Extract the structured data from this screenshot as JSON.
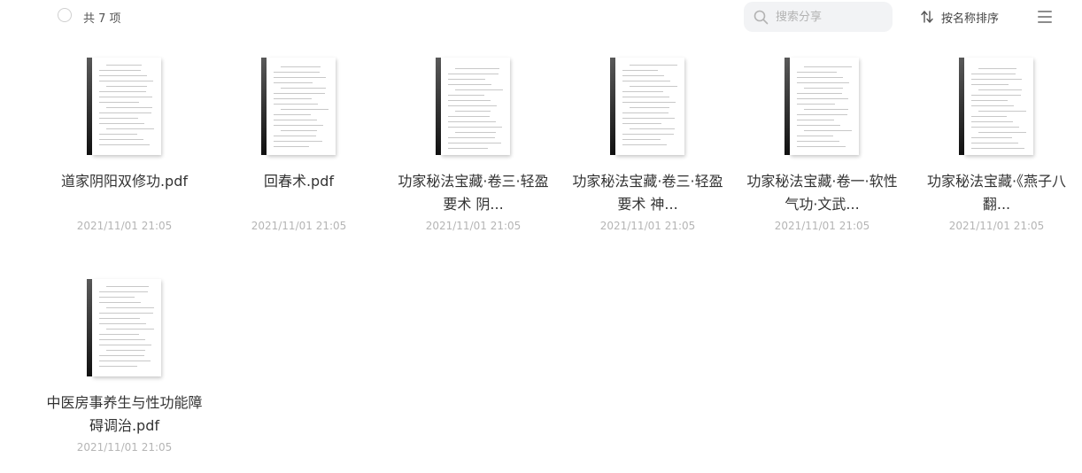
{
  "toolbar": {
    "count_label": "共 7 项",
    "search_placeholder": "搜索分享",
    "sort_label": "按名称排序"
  },
  "files": [
    {
      "name": "道家阴阳双修功.pdf",
      "date": "2021/11/01 21:05"
    },
    {
      "name": "回春术.pdf",
      "date": "2021/11/01 21:05"
    },
    {
      "name": "功家秘法宝藏·卷三·轻盈要术 阴...",
      "date": "2021/11/01 21:05"
    },
    {
      "name": "功家秘法宝藏·卷三·轻盈要术 神...",
      "date": "2021/11/01 21:05"
    },
    {
      "name": "功家秘法宝藏·卷一·软性气功·文武...",
      "date": "2021/11/01 21:05"
    },
    {
      "name": "功家秘法宝藏·《燕子八翻...",
      "date": "2021/11/01 21:05"
    },
    {
      "name": "中医房事养生与性功能障碍调治.pdf",
      "date": "2021/11/01 21:05"
    }
  ],
  "icons": {
    "search": "search-icon",
    "sort": "sort-icon",
    "menu": "menu-icon",
    "file": "pdf-thumbnail"
  },
  "colors": {
    "text": "#333333",
    "muted": "#b5b5b5",
    "search_bg": "#f2f3f5"
  }
}
